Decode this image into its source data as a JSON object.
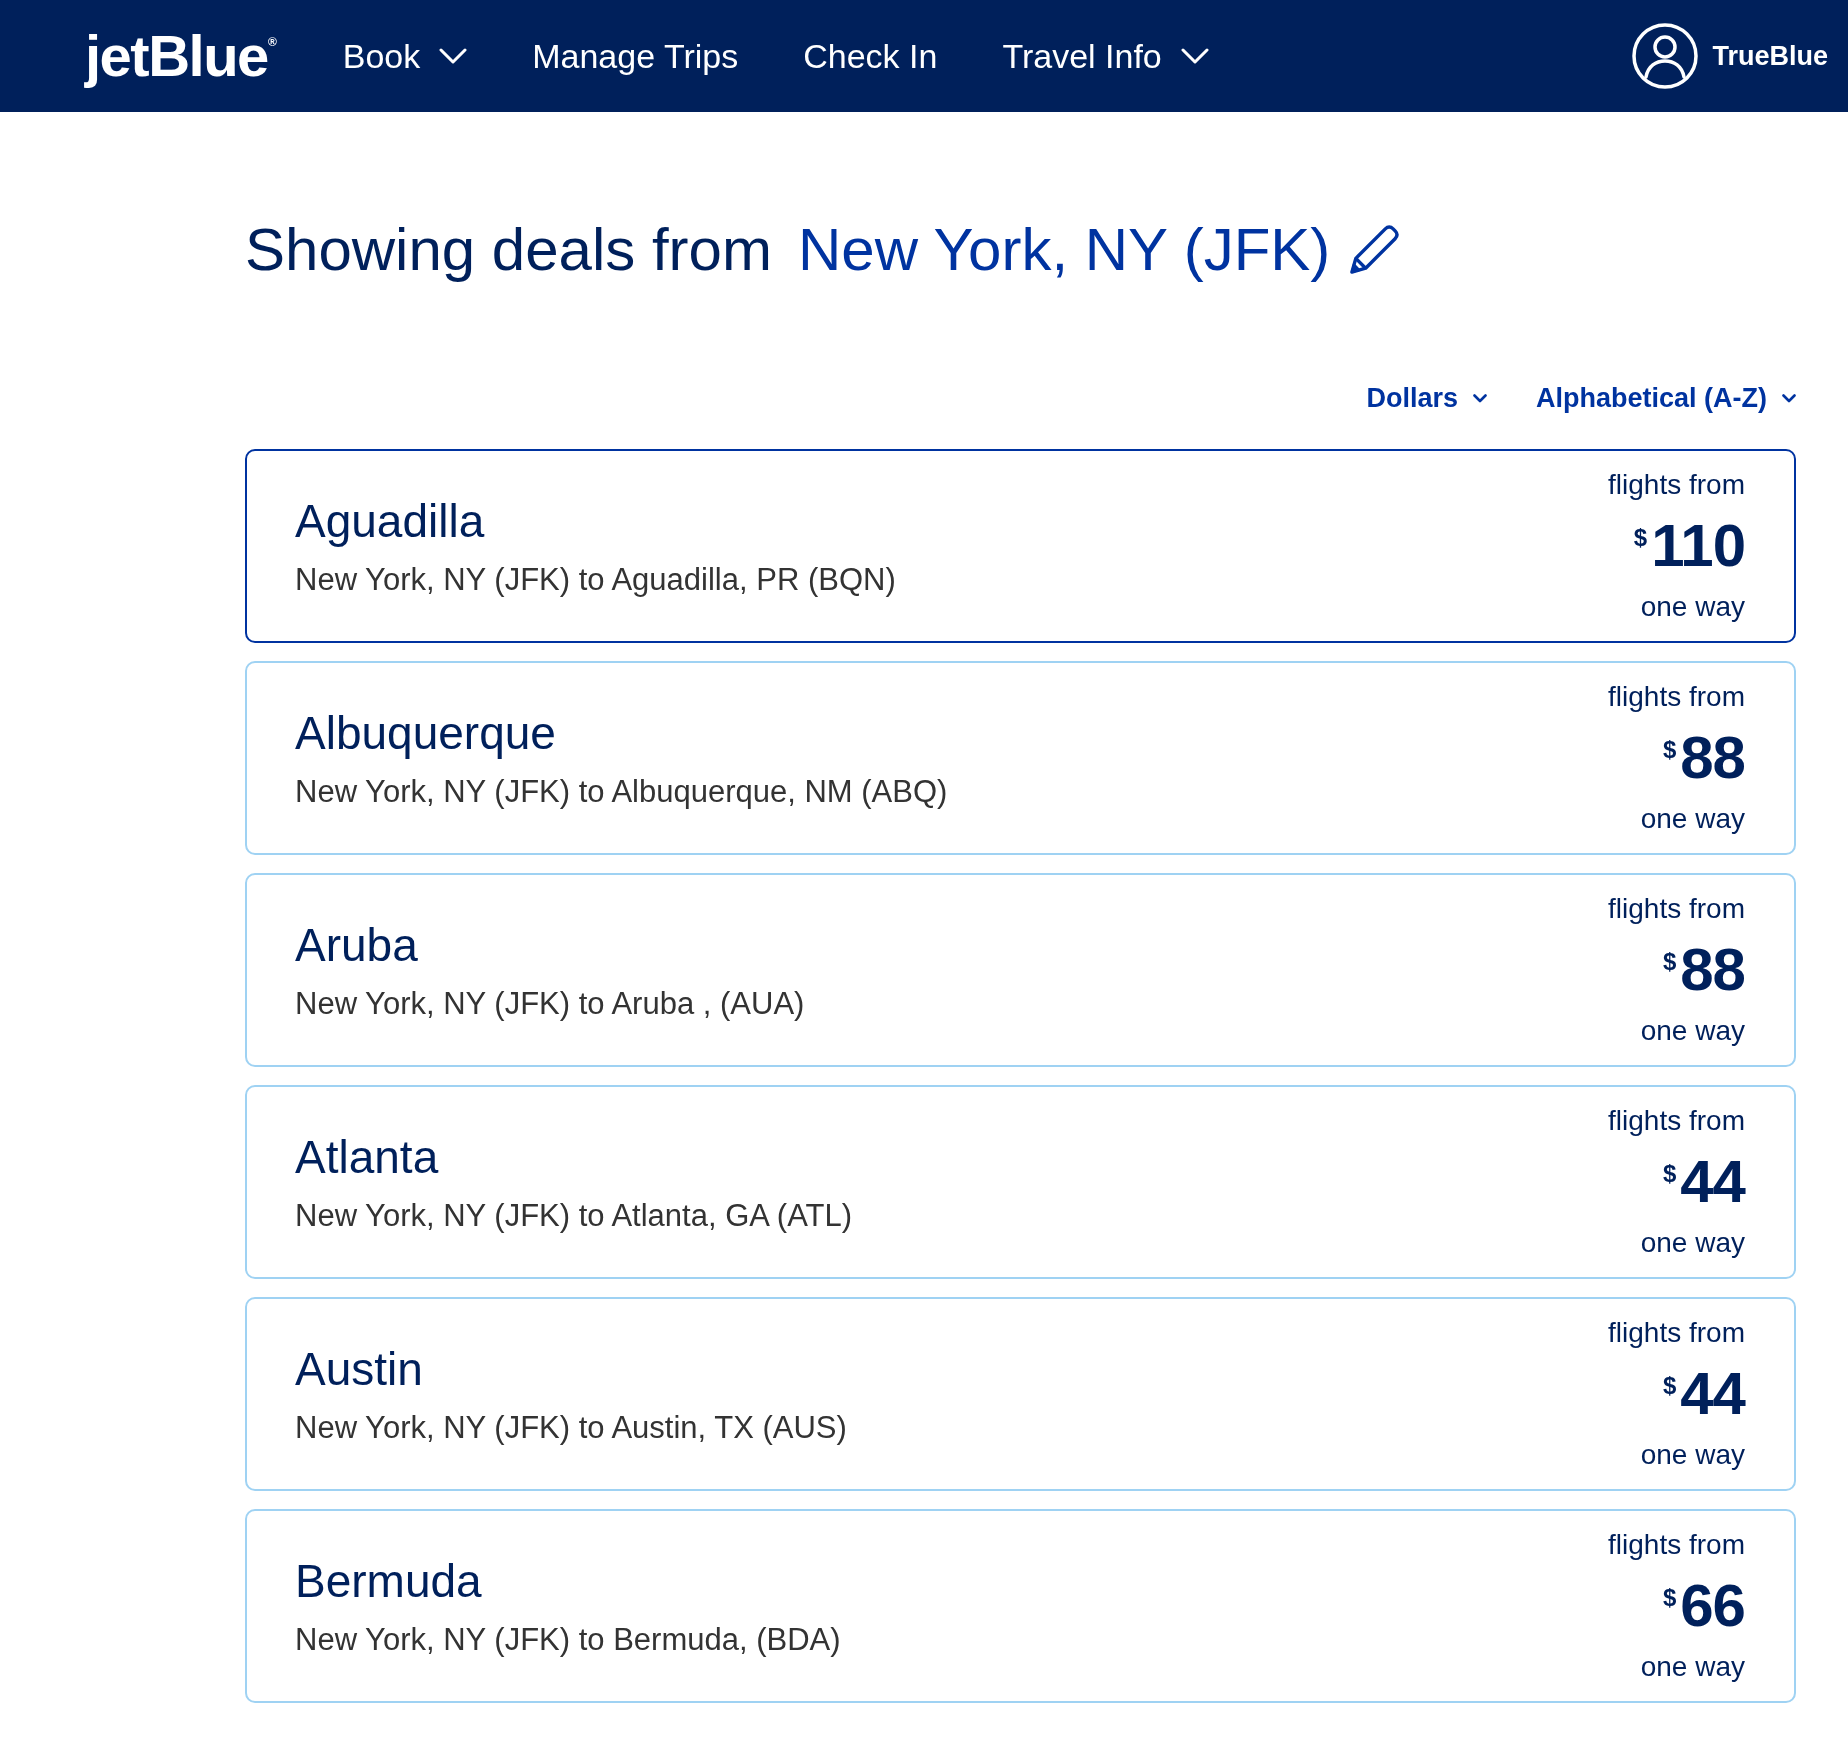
{
  "header": {
    "logo": "jetBlue$^{®}$",
    "nav": [
      {
        "label": "Book",
        "has_menu": true
      },
      {
        "label": "Manage Trips",
        "has_menu": false
      },
      {
        "label": "Check In",
        "has_menu": false
      },
      {
        "label": "Travel Info",
        "has_menu": true
      }
    ],
    "account": {
      "label": "TrueBlue"
    }
  },
  "heading": {
    "text": "Showing deals from",
    "origin": "New York, NY (JFK)"
  },
  "sort": [
    {
      "label": "Dollars"
    },
    {
      "label": "Alphabetical (A-Z)"
    }
  ],
  "deals": [
    {
      "city": "Aguadilla",
      "route": "New York, NY (JFK) to Aguadilla, PR (BQN)",
      "caption": "flights from",
      "currency_symbol": "$",
      "price": "110",
      "trip": "one way",
      "selected": true
    },
    {
      "city": "Albuquerque",
      "route": "New York, NY (JFK) to Albuquerque, NM (ABQ)",
      "caption": "flights from",
      "currency_symbol": "$",
      "price": "88",
      "trip": "one way",
      "selected": false
    },
    {
      "city": "Aruba",
      "route": "New York, NY (JFK) to Aruba , (AUA)",
      "caption": "flights from",
      "currency_symbol": "$",
      "price": "88",
      "trip": "one way",
      "selected": false
    },
    {
      "city": "Atlanta",
      "route": "New York, NY (JFK) to Atlanta, GA (ATL)",
      "caption": "flights from",
      "currency_symbol": "$",
      "price": "44",
      "trip": "one way",
      "selected": false
    },
    {
      "city": "Austin",
      "route": "New York, NY (JFK) to Austin, TX (AUS)",
      "caption": "flights from",
      "currency_symbol": "$",
      "price": "44",
      "trip": "one way",
      "selected": false
    },
    {
      "city": "Bermuda",
      "route": "New York, NY (JFK) to Bermuda, (BDA)",
      "caption": "flights from",
      "currency_symbol": "$",
      "price": "66",
      "trip": "one way",
      "selected": false
    }
  ]
}
